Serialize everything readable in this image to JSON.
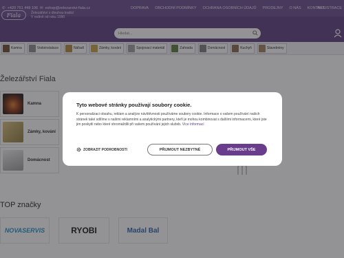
{
  "topbar": {
    "phone": "+420 751 448 106",
    "email": "eshop@zelezarstvi-fiala.cz",
    "nav": [
      "DOPRAVA",
      "OBCHODNÍ PODMÍNKY",
      "OCHRANA OSOBNÍCH ÚDAJŮ",
      "PRODEJNY",
      "O NÁS",
      "KONTAKT"
    ],
    "login": "REGISTRACE",
    "cart": "Košík prázdný"
  },
  "header": {
    "logo": "Fiala",
    "tagline_line1": "Železářství s dlouhou tradicí",
    "tagline_line2": "V rodině od roku 1990",
    "search_placeholder": "Hledat..."
  },
  "categories": [
    "Kamna",
    "Vodoinstalace",
    "Nářadí",
    "Zámky, kování",
    "Spojovací materiál",
    "Zahrada",
    "Domácnost",
    "Kuchyň",
    "Stavebniny"
  ],
  "page_title": "Železářství Fiala",
  "cards": [
    "Kamna",
    "Zámky, kování",
    "Domácnost"
  ],
  "brands_title": "TOP značky",
  "brands": [
    "NOVASERVIS",
    "RYOBI",
    "Madal Bal"
  ],
  "cookie": {
    "title": "Tyto webové stránky používají soubory cookie.",
    "body": "K personalizaci obsahu, reklam a analýze návštěvnosti používáme soubory cookie. Informace o vašem používání našich stránek také sdílíme s našimi reklamními a analytickými partnery, kteří je mohou kombinovat s dalšími informacemi, které jste jim poskytli nebo které shromáždili při vašem používání jejich služeb.",
    "more": "Více informací",
    "details": "ZOBRAZIT PODROBNOSTI",
    "necessary": "PŘIJMOUT NEZBYTNÉ",
    "accept_all": "PŘIJMOUT VŠE"
  },
  "colors": {
    "brand": "#5c3d7e",
    "accept": "#6a3d8c"
  }
}
